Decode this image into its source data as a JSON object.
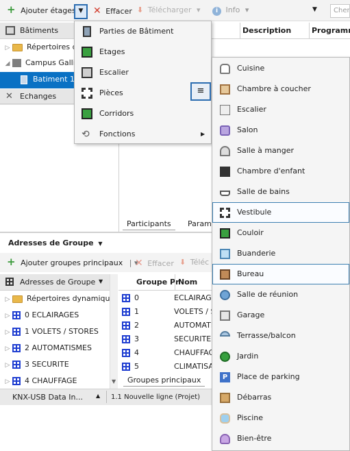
{
  "toolbar": {
    "add_floors": "Ajouter étages",
    "delete": "Effacer",
    "download": "Télécharger",
    "info": "Info",
    "search_placeholder": "Cherc"
  },
  "tree_header": "Bâtiments",
  "tree": {
    "repertoires": "Répertoires d",
    "campus": "Campus Galli",
    "batiment1": "Batiment 1",
    "echanges": "Echanges"
  },
  "table_headers": [
    "Description",
    "Programm"
  ],
  "tabs_top": [
    "Participants",
    "Paramè"
  ],
  "menu1": [
    {
      "label": "Parties de Bâtiment",
      "icon": "building-parts-icon"
    },
    {
      "label": "Etages",
      "icon": "floors-icon"
    },
    {
      "label": "Escalier",
      "icon": "stairs-icon"
    },
    {
      "label": "Pièces",
      "icon": "rooms-icon"
    },
    {
      "label": "Corridors",
      "icon": "corridors-icon"
    },
    {
      "label": "Fonctions",
      "icon": "functions-icon"
    }
  ],
  "menu2": [
    {
      "label": "Cuisine",
      "icon": "chef-hat-icon"
    },
    {
      "label": "Chambre à coucher",
      "icon": "bed-icon"
    },
    {
      "label": "Escalier",
      "icon": "stairs-icon"
    },
    {
      "label": "Salon",
      "icon": "sofa-icon"
    },
    {
      "label": "Salle à manger",
      "icon": "cloche-icon"
    },
    {
      "label": "Chambre d'enfant",
      "icon": "puzzle-icon"
    },
    {
      "label": "Salle de bains",
      "icon": "bath-icon"
    },
    {
      "label": "Vestibule",
      "icon": "vestibule-icon"
    },
    {
      "label": "Couloir",
      "icon": "corridor-icon"
    },
    {
      "label": "Buanderie",
      "icon": "laundry-icon"
    },
    {
      "label": "Bureau",
      "icon": "desk-icon"
    },
    {
      "label": "Salle de réunion",
      "icon": "meeting-icon"
    },
    {
      "label": "Garage",
      "icon": "garage-icon"
    },
    {
      "label": "Terrasse/balcon",
      "icon": "parasol-icon"
    },
    {
      "label": "Jardin",
      "icon": "tree-icon"
    },
    {
      "label": "Place de parking",
      "icon": "parking-icon"
    },
    {
      "label": "Débarras",
      "icon": "boxes-icon"
    },
    {
      "label": "Piscine",
      "icon": "pool-icon"
    },
    {
      "label": "Bien-être",
      "icon": "lotus-icon"
    }
  ],
  "group": {
    "title": "Adresses de Groupe",
    "add_main": "Ajouter groupes principaux",
    "delete": "Effacer",
    "download": "Téléc",
    "tree_header": "Adresses de Groupe",
    "tree": [
      "Répertoires dynamiqu",
      "0 ECLAIRAGES",
      "1 VOLETS / STORES",
      "2 AUTOMATISMES",
      "3 SECURITE",
      "4 CHAUFFAGE"
    ],
    "cols": [
      "Groupe Pr",
      "Nom"
    ],
    "rows": [
      {
        "num": "0",
        "name": "ECLAIRAG"
      },
      {
        "num": "1",
        "name": "VOLETS / S"
      },
      {
        "num": "2",
        "name": "AUTOMATI"
      },
      {
        "num": "3",
        "name": "SECURITE"
      },
      {
        "num": "4",
        "name": "CHAUFFAG"
      },
      {
        "num": "5",
        "name": "CLIMATISA"
      }
    ],
    "tab": "Groupes principaux"
  },
  "status": {
    "interface": "KNX-USB Data In...",
    "line": "1.1 Nouvelle ligne (Projet)"
  }
}
